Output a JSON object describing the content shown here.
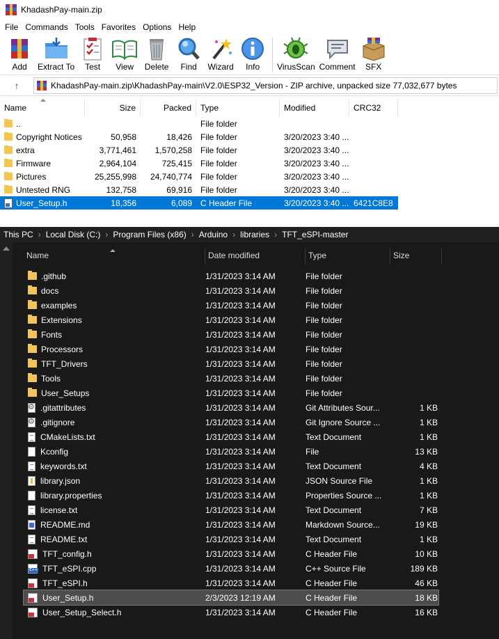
{
  "rar": {
    "title": "KhadashPay-main.zip",
    "menu": [
      "File",
      "Commands",
      "Tools",
      "Favorites",
      "Options",
      "Help"
    ],
    "toolbar": [
      {
        "label": "Add",
        "icon": "add-archive-icon"
      },
      {
        "label": "Extract To",
        "icon": "extract-folder-icon"
      },
      {
        "label": "Test",
        "icon": "test-checklist-icon"
      },
      {
        "label": "View",
        "icon": "view-book-icon"
      },
      {
        "label": "Delete",
        "icon": "trash-can-icon"
      },
      {
        "label": "Find",
        "icon": "magnifier-icon"
      },
      {
        "label": "Wizard",
        "icon": "magic-wand-icon"
      },
      {
        "label": "Info",
        "icon": "info-icon"
      },
      {
        "label": "VirusScan",
        "icon": "virus-bug-icon"
      },
      {
        "label": "Comment",
        "icon": "comment-bubble-icon"
      },
      {
        "label": "SFX",
        "icon": "sfx-box-icon"
      }
    ],
    "address": "KhadashPay-main.zip\\KhadashPay-main\\V2.0\\ESP32_Version - ZIP archive, unpacked size 77,032,677 bytes",
    "columns": {
      "name": "Name",
      "size": "Size",
      "packed": "Packed",
      "type": "Type",
      "modified": "Modified",
      "crc": "CRC32"
    },
    "rows": [
      {
        "name": "..",
        "size": "",
        "packed": "",
        "type": "File folder",
        "modified": "",
        "crc": "",
        "kind": "folder"
      },
      {
        "name": "Copyright Notices",
        "size": "50,958",
        "packed": "18,426",
        "type": "File folder",
        "modified": "3/20/2023 3:40 ...",
        "crc": "",
        "kind": "folder"
      },
      {
        "name": "extra",
        "size": "3,771,461",
        "packed": "1,570,258",
        "type": "File folder",
        "modified": "3/20/2023 3:40 ...",
        "crc": "",
        "kind": "folder"
      },
      {
        "name": "Firmware",
        "size": "2,964,104",
        "packed": "725,415",
        "type": "File folder",
        "modified": "3/20/2023 3:40 ...",
        "crc": "",
        "kind": "folder"
      },
      {
        "name": "Pictures",
        "size": "25,255,998",
        "packed": "24,740,774",
        "type": "File folder",
        "modified": "3/20/2023 3:40 ...",
        "crc": "",
        "kind": "folder"
      },
      {
        "name": "Untested RNG",
        "size": "132,758",
        "packed": "69,916",
        "type": "File folder",
        "modified": "3/20/2023 3:40 ...",
        "crc": "",
        "kind": "folder"
      },
      {
        "name": "User_Setup.h",
        "size": "18,356",
        "packed": "6,089",
        "type": "C Header File",
        "modified": "3/20/2023 3:40 ...",
        "crc": "6421C8E8",
        "kind": "header",
        "selected": true
      }
    ]
  },
  "explorer": {
    "breadcrumb": [
      "This PC",
      "Local Disk (C:)",
      "Program Files (x86)",
      "Arduino",
      "libraries",
      "TFT_eSPI-master"
    ],
    "columns": {
      "name": "Name",
      "date": "Date modified",
      "type": "Type",
      "size": "Size"
    },
    "rows": [
      {
        "name": ".github",
        "date": "1/31/2023 3:14 AM",
        "type": "File folder",
        "size": "",
        "icon": "folder"
      },
      {
        "name": "docs",
        "date": "1/31/2023 3:14 AM",
        "type": "File folder",
        "size": "",
        "icon": "folder"
      },
      {
        "name": "examples",
        "date": "1/31/2023 3:14 AM",
        "type": "File folder",
        "size": "",
        "icon": "folder"
      },
      {
        "name": "Extensions",
        "date": "1/31/2023 3:14 AM",
        "type": "File folder",
        "size": "",
        "icon": "folder"
      },
      {
        "name": "Fonts",
        "date": "1/31/2023 3:14 AM",
        "type": "File folder",
        "size": "",
        "icon": "folder"
      },
      {
        "name": "Processors",
        "date": "1/31/2023 3:14 AM",
        "type": "File folder",
        "size": "",
        "icon": "folder"
      },
      {
        "name": "TFT_Drivers",
        "date": "1/31/2023 3:14 AM",
        "type": "File folder",
        "size": "",
        "icon": "folder"
      },
      {
        "name": "Tools",
        "date": "1/31/2023 3:14 AM",
        "type": "File folder",
        "size": "",
        "icon": "folder"
      },
      {
        "name": "User_Setups",
        "date": "1/31/2023 3:14 AM",
        "type": "File folder",
        "size": "",
        "icon": "folder"
      },
      {
        "name": ".gitattributes",
        "date": "1/31/2023 3:14 AM",
        "type": "Git Attributes Sour...",
        "size": "1 KB",
        "icon": "gear"
      },
      {
        "name": ".gitignore",
        "date": "1/31/2023 3:14 AM",
        "type": "Git Ignore Source ...",
        "size": "1 KB",
        "icon": "gear"
      },
      {
        "name": "CMakeLists.txt",
        "date": "1/31/2023 3:14 AM",
        "type": "Text Document",
        "size": "1 KB",
        "icon": "lines"
      },
      {
        "name": "Kconfig",
        "date": "1/31/2023 3:14 AM",
        "type": "File",
        "size": "13 KB",
        "icon": "plain"
      },
      {
        "name": "keywords.txt",
        "date": "1/31/2023 3:14 AM",
        "type": "Text Document",
        "size": "4 KB",
        "icon": "lines"
      },
      {
        "name": "library.json",
        "date": "1/31/2023 3:14 AM",
        "type": "JSON Source File",
        "size": "1 KB",
        "icon": "json"
      },
      {
        "name": "library.properties",
        "date": "1/31/2023 3:14 AM",
        "type": "Properties Source ...",
        "size": "1 KB",
        "icon": "plain"
      },
      {
        "name": "license.txt",
        "date": "1/31/2023 3:14 AM",
        "type": "Text Document",
        "size": "7 KB",
        "icon": "lines"
      },
      {
        "name": "README.md",
        "date": "1/31/2023 3:14 AM",
        "type": "Markdown Source...",
        "size": "19 KB",
        "icon": "blue"
      },
      {
        "name": "README.txt",
        "date": "1/31/2023 3:14 AM",
        "type": "Text Document",
        "size": "1 KB",
        "icon": "lines"
      },
      {
        "name": "TFT_config.h",
        "date": "1/31/2023 3:14 AM",
        "type": "C Header File",
        "size": "10 KB",
        "icon": "hdr"
      },
      {
        "name": "TFT_eSPI.cpp",
        "date": "1/31/2023 3:14 AM",
        "type": "C++ Source File",
        "size": "189 KB",
        "icon": "cpp"
      },
      {
        "name": "TFT_eSPI.h",
        "date": "1/31/2023 3:14 AM",
        "type": "C Header File",
        "size": "46 KB",
        "icon": "hdr"
      },
      {
        "name": "User_Setup.h",
        "date": "2/3/2023 12:19 AM",
        "type": "C Header File",
        "size": "18 KB",
        "icon": "hdr",
        "selected": true
      },
      {
        "name": "User_Setup_Select.h",
        "date": "1/31/2023 3:14 AM",
        "type": "C Header File",
        "size": "16 KB",
        "icon": "hdr"
      }
    ]
  }
}
